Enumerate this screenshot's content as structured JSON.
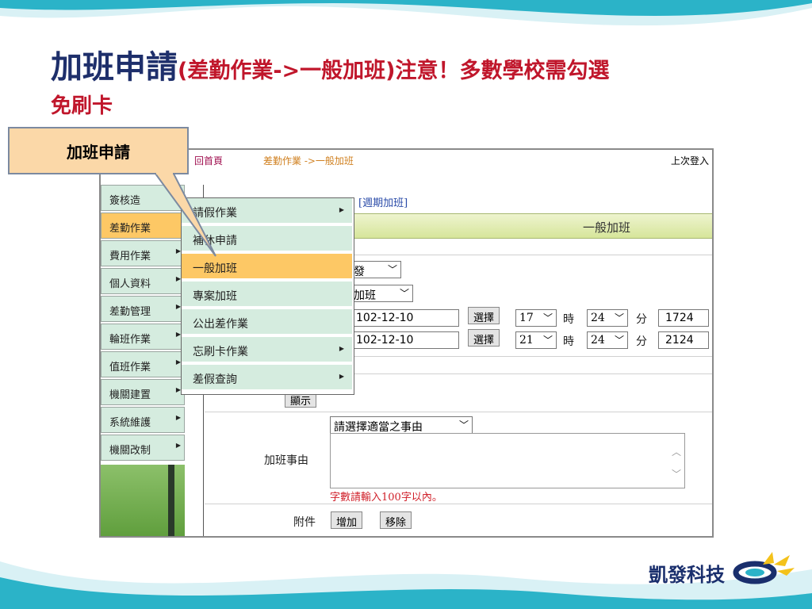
{
  "title": {
    "main": "加班申請",
    "sub": "(差勤作業->一般加班)注意！多數學校需勾選",
    "line2": "免刷卡"
  },
  "callout": "加班申請",
  "app": {
    "topbar": {
      "home": "回首頁",
      "breadcrumb": "差勤作業 ->一般加班",
      "last_login": "上次登入"
    },
    "sidebar": [
      {
        "label": "簽核造"
      },
      {
        "label": "差勤作業"
      },
      {
        "label": "費用作業"
      },
      {
        "label": "個人資料"
      },
      {
        "label": "差勤管理"
      },
      {
        "label": "輪班作業"
      },
      {
        "label": "值班作業"
      },
      {
        "label": "機關建置"
      },
      {
        "label": "系統維護"
      },
      {
        "label": "機關改制"
      }
    ],
    "links": {
      "partial": "…[…] …[…] [週期加班]",
      "period": "[週期加班]"
    },
    "section_title": "一般加班",
    "form": {
      "unit": "大發",
      "type": "般加班",
      "start_date": "102-12-10",
      "end_date": "102-12-10",
      "choose_label": "選擇",
      "start_hour": "17",
      "start_min": "24",
      "start_code": "1724",
      "end_hour": "21",
      "end_min": "24",
      "end_code": "2124",
      "hour_label": "時",
      "min_label": "分",
      "show_button": "顯示",
      "reason_select": "請選擇適當之事由",
      "reason_label": "加班事由",
      "reason_hint": "字數請輸入100字以內。",
      "attach_label": "附件",
      "add_button": "增加",
      "remove_button": "移除"
    }
  },
  "popup_menu": [
    {
      "label": "請假作業",
      "submenu": true
    },
    {
      "label": "補休申請",
      "submenu": false
    },
    {
      "label": "一般加班",
      "submenu": false
    },
    {
      "label": "專案加班",
      "submenu": false
    },
    {
      "label": "公出差作業",
      "submenu": false
    },
    {
      "label": "忘刷卡作業",
      "submenu": true
    },
    {
      "label": "差假查詢",
      "submenu": true
    }
  ],
  "brand": "凱發科技",
  "colors": {
    "title_red": "#c0162b",
    "title_navy": "#1e2f6b",
    "menu_active": "#fdc865",
    "menu_bg": "#d5ecdf",
    "wave": "#2bb3c8"
  }
}
